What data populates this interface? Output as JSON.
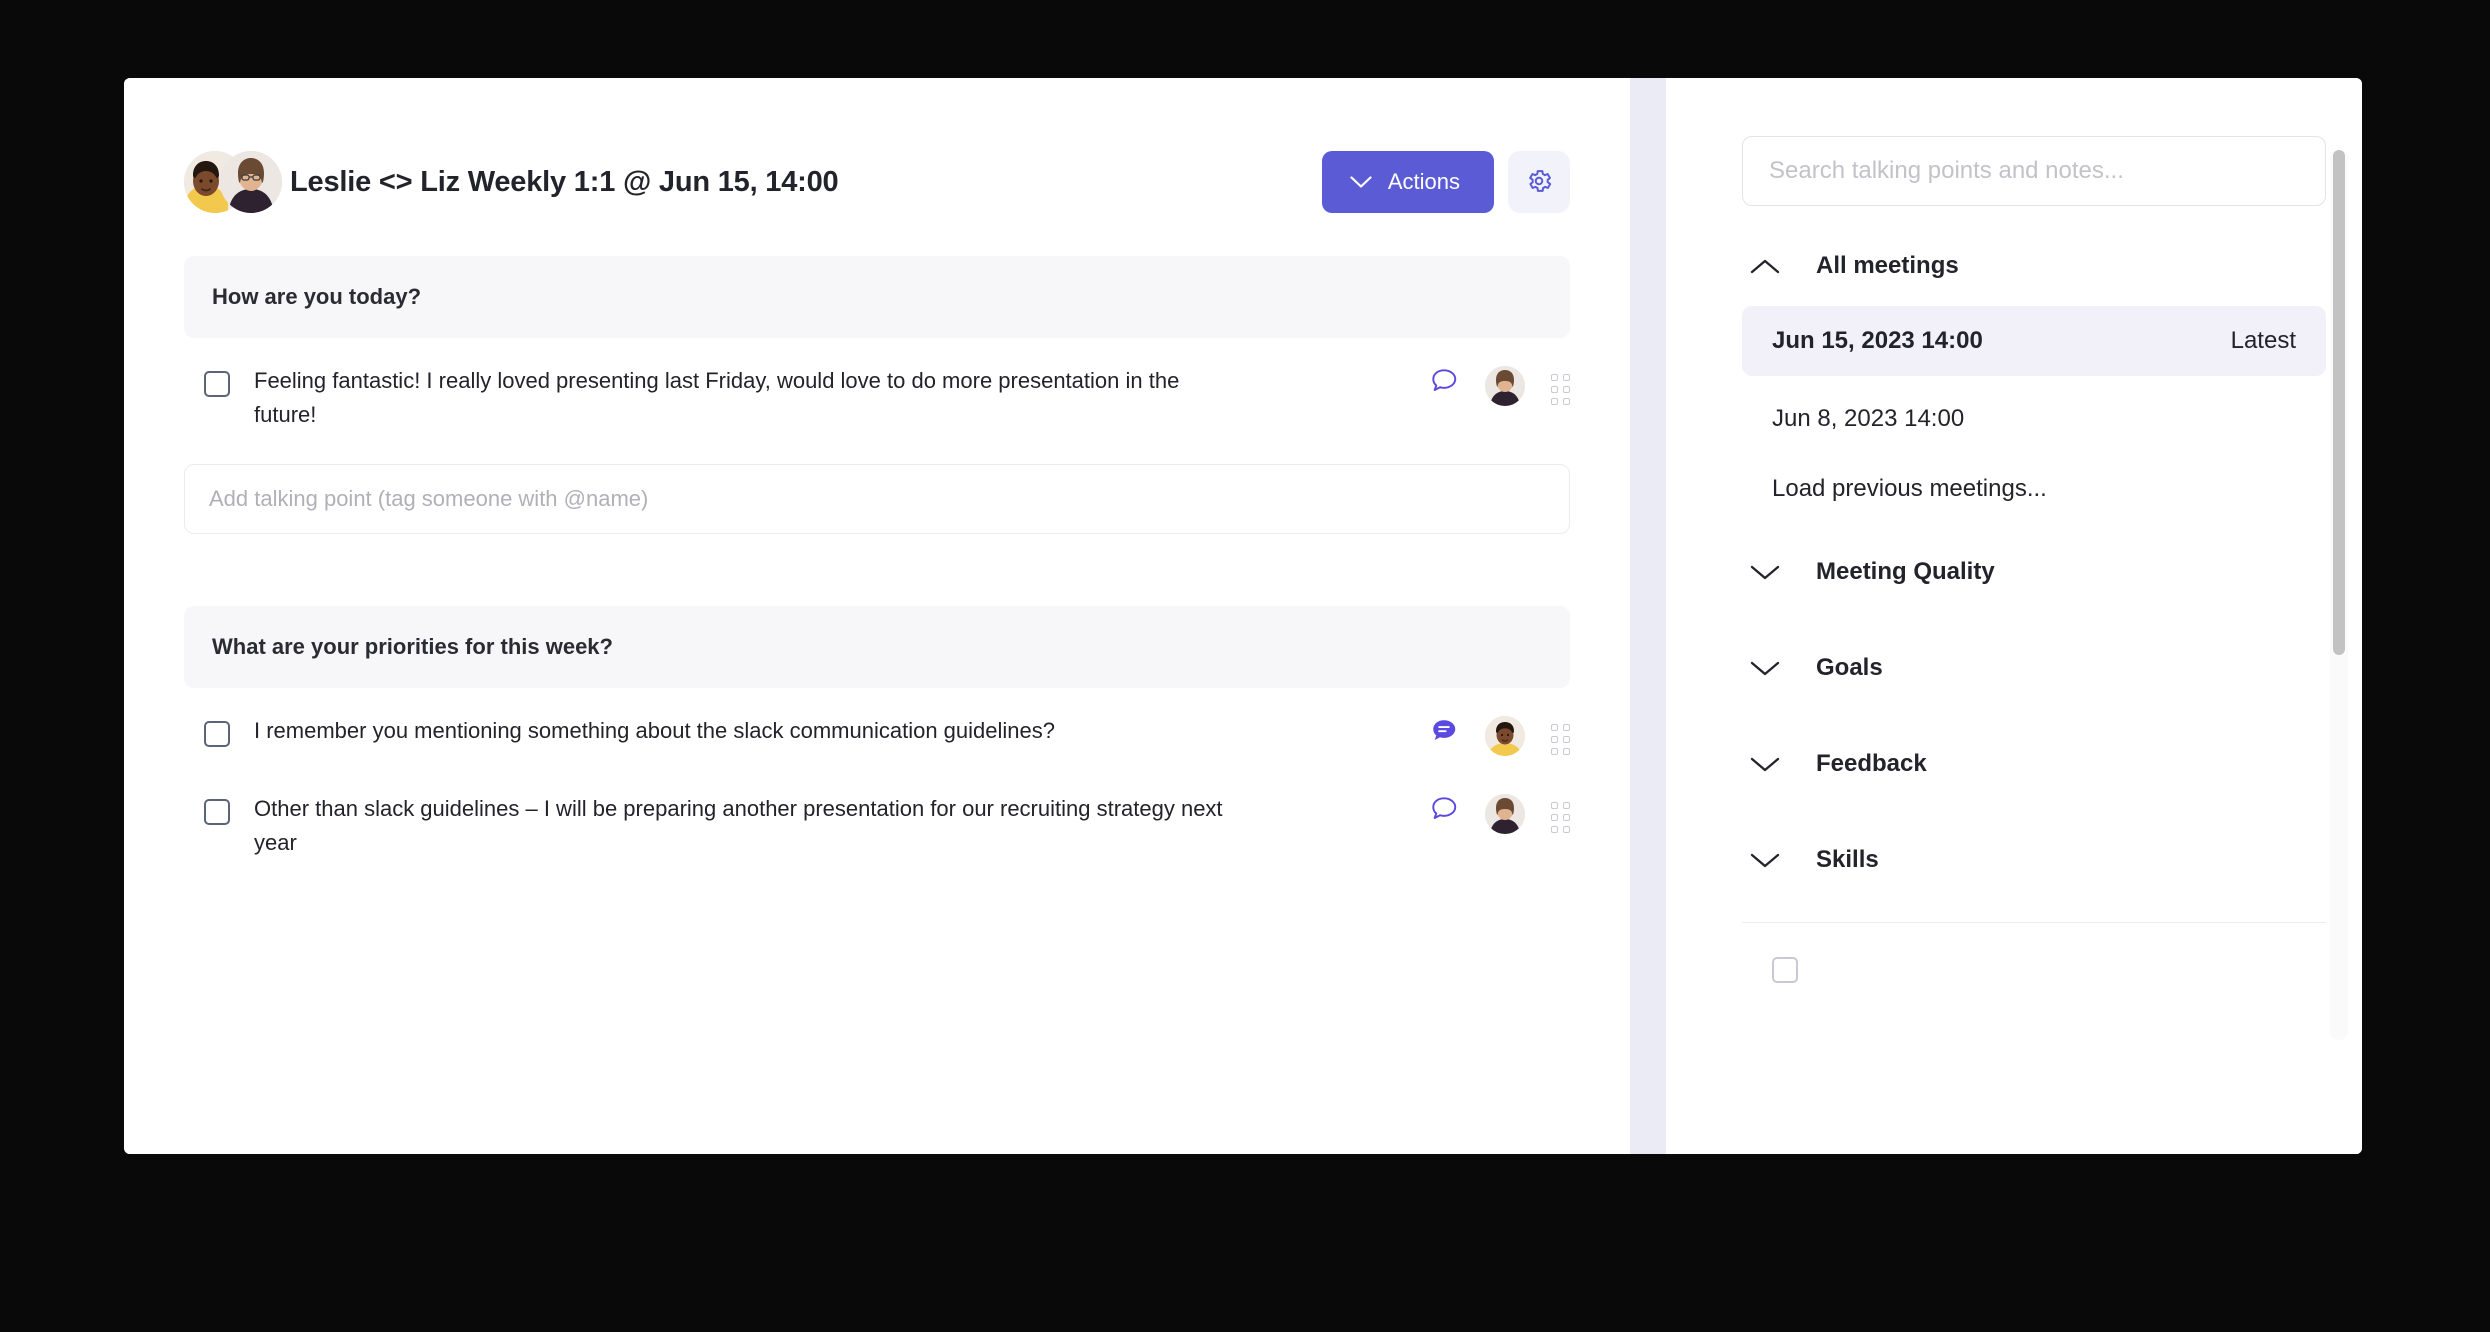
{
  "meeting": {
    "title": "Leslie <> Liz Weekly 1:1 @ Jun 15, 14:00",
    "actions_label": "Actions",
    "gear_icon": "gear-icon",
    "chevron_icon": "chevron-down-icon"
  },
  "sections": [
    {
      "heading": "How are you today?",
      "talking_points": [
        {
          "text": "Feeling fantastic! I really loved presenting last Friday, would love to do more presentation in the future!",
          "checked": false,
          "comment_state": "empty",
          "avatar": "liz-avatar"
        }
      ],
      "add_placeholder": "Add talking point (tag someone with @name)"
    },
    {
      "heading": "What are your priorities for this week?",
      "talking_points": [
        {
          "text": "I remember you mentioning something about the slack communication guidelines?",
          "checked": false,
          "comment_state": "filled",
          "avatar": "leslie-avatar"
        },
        {
          "text": "Other than slack guidelines – I will be preparing another presentation for our recruiting strategy next year",
          "checked": false,
          "comment_state": "empty",
          "avatar": "liz-avatar"
        }
      ]
    }
  ],
  "sidebar": {
    "search_placeholder": "Search talking points and notes...",
    "all_meetings_label": "All meetings",
    "all_meetings_expanded": true,
    "meetings": [
      {
        "date": "Jun 15, 2023 14:00",
        "tag": "Latest",
        "selected": true
      },
      {
        "date": "Jun 8, 2023 14:00",
        "tag": "",
        "selected": false
      }
    ],
    "load_more_label": "Load previous meetings...",
    "collapsed_sections": [
      {
        "label": "Meeting Quality"
      },
      {
        "label": "Goals"
      },
      {
        "label": "Feedback"
      },
      {
        "label": "Skills"
      }
    ]
  },
  "colors": {
    "accent": "#5b5bd6",
    "selected_row": "#f2f1fa",
    "section_header_bg": "#f7f7f9",
    "panel_gap": "#ebebf6"
  }
}
